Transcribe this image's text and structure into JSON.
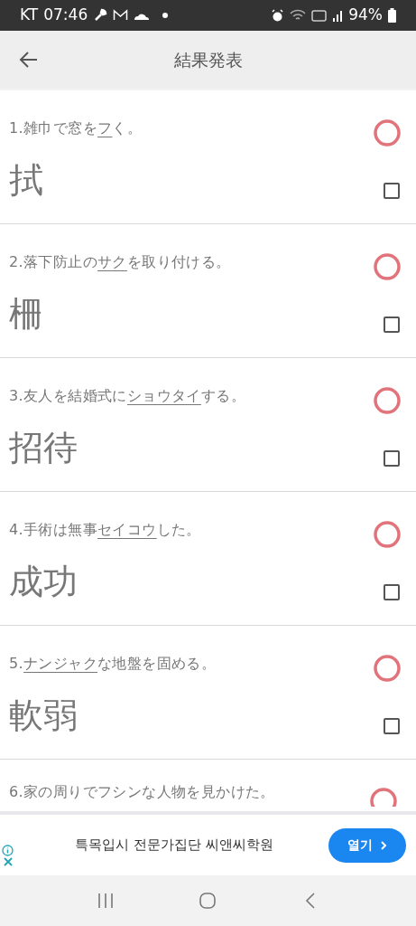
{
  "status_bar": {
    "carrier": "KT",
    "time": "07:46",
    "battery": "94%"
  },
  "header": {
    "title": "結果発表"
  },
  "questions": [
    {
      "kind": "full",
      "number": "1.",
      "parts": [
        {
          "text": "雑巾で窓を",
          "underlined": false
        },
        {
          "text": "フ",
          "underlined": true
        },
        {
          "text": "く。",
          "underlined": false
        }
      ],
      "answer": "拭",
      "correct": true,
      "checked": false
    },
    {
      "kind": "full",
      "number": "2.",
      "parts": [
        {
          "text": "落下防止の",
          "underlined": false
        },
        {
          "text": "サク",
          "underlined": true
        },
        {
          "text": "を取り付ける。",
          "underlined": false
        }
      ],
      "answer": "柵",
      "correct": true,
      "checked": false
    },
    {
      "kind": "full",
      "number": "3.",
      "parts": [
        {
          "text": "友人を結婚式に",
          "underlined": false
        },
        {
          "text": "ショウタイ",
          "underlined": true
        },
        {
          "text": "する。",
          "underlined": false
        }
      ],
      "answer": "招待",
      "correct": true,
      "checked": false
    },
    {
      "kind": "full",
      "number": "4.",
      "parts": [
        {
          "text": "手術は無事",
          "underlined": false
        },
        {
          "text": "セイコウ",
          "underlined": true
        },
        {
          "text": "した。",
          "underlined": false
        }
      ],
      "answer": "成功",
      "correct": true,
      "checked": false
    },
    {
      "kind": "full",
      "number": "5.",
      "parts": [
        {
          "text": "ナンジャク",
          "underlined": true
        },
        {
          "text": "な地盤を固める。",
          "underlined": false
        }
      ],
      "answer": "軟弱",
      "correct": true,
      "checked": false
    },
    {
      "kind": "partial",
      "number": "6.",
      "parts": [
        {
          "text": "家の周りでフシンな人物を見かけた。",
          "underlined": false
        }
      ],
      "correct": true
    }
  ],
  "ad": {
    "text": "특목입시 전문가집단 씨앤씨학원",
    "button": "열기"
  }
}
